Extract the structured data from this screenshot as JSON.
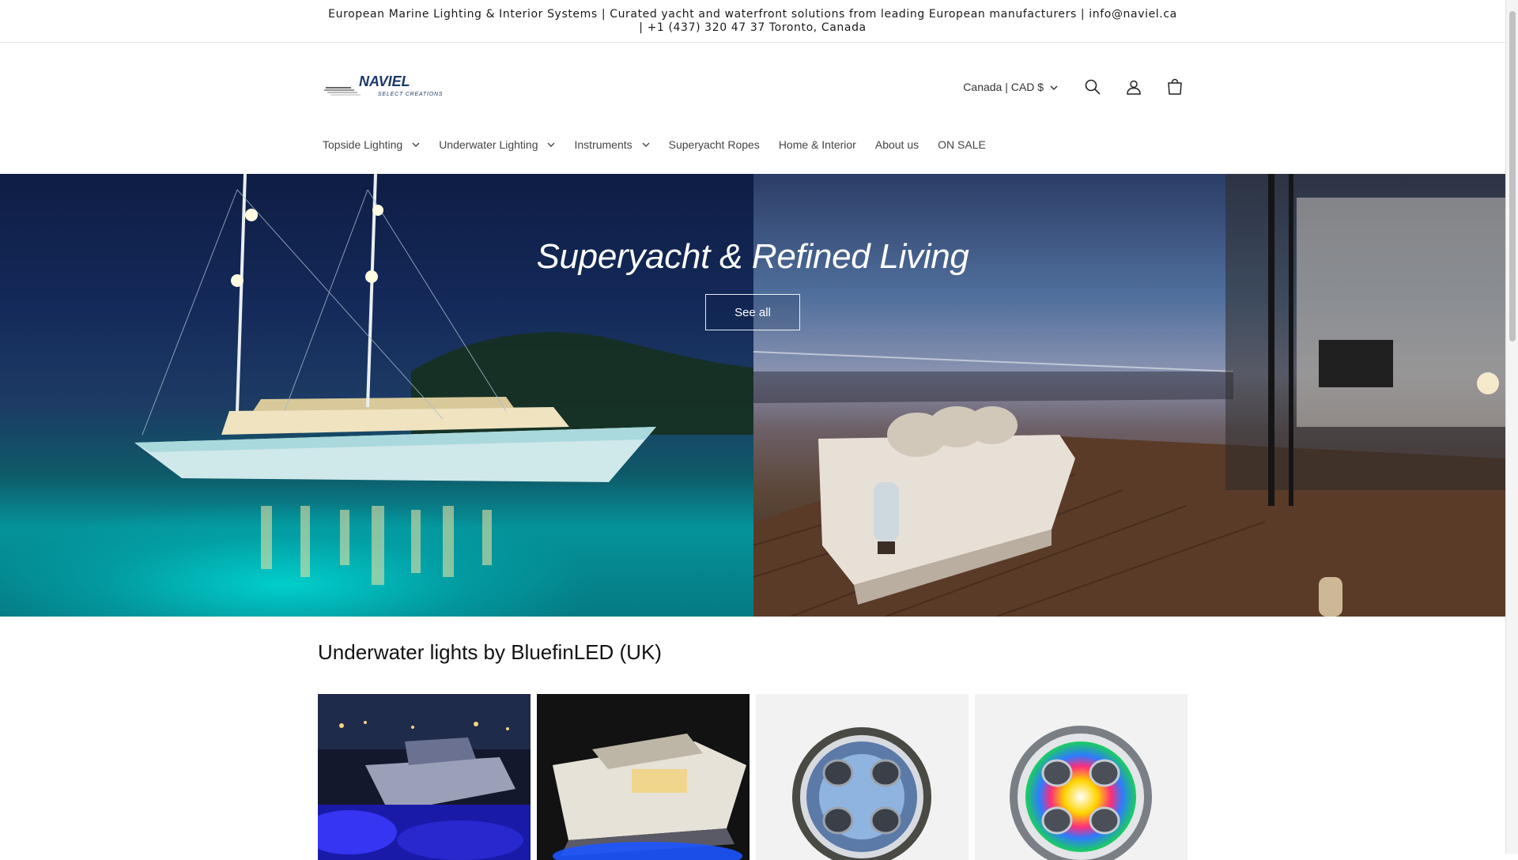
{
  "announcement": {
    "text": "European Marine Lighting & Interior Systems | Curated yacht and waterfront solutions from leading European manufacturers | info@naviel.ca | +1 (437) 320 47 37 Toronto, Canada"
  },
  "header": {
    "logo_text": "NAVIEL",
    "logo_tagline": "SELECT CREATIONS",
    "locale": "Canada | CAD $",
    "icons": [
      "search-icon",
      "account-icon",
      "cart-icon"
    ]
  },
  "nav": {
    "items": [
      {
        "label": "Topside Lighting",
        "dropdown": true
      },
      {
        "label": "Underwater Lighting",
        "dropdown": true
      },
      {
        "label": "Instruments",
        "dropdown": true
      },
      {
        "label": "Superyacht Ropes",
        "dropdown": false
      },
      {
        "label": "Home & Interior",
        "dropdown": false
      },
      {
        "label": "About us",
        "dropdown": false
      },
      {
        "label": "ON SALE",
        "dropdown": false
      }
    ]
  },
  "hero": {
    "title": "Superyacht & Refined Living",
    "button_label": "See all"
  },
  "collection": {
    "title": "Underwater lights by BluefinLED (UK)",
    "cards": [
      {
        "image": "yacht-marina-night-blue-underwater-light"
      },
      {
        "image": "motor-yacht-night-blue-underwater-light"
      },
      {
        "image": "bluefin-led-fixture-blue"
      },
      {
        "image": "bluefin-led-fixture-rgb"
      }
    ]
  },
  "colors": {
    "text": "#121212",
    "hero_text": "#ffffff",
    "logo_blue": "#1b3a6b"
  }
}
